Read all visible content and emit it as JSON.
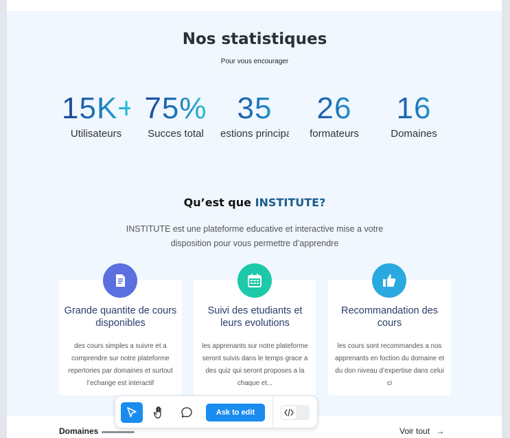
{
  "stats": {
    "title": "Nos statistiques",
    "subtitle": "Pour vous encourager",
    "items": [
      {
        "value": "15K+",
        "label": "Utilisateurs"
      },
      {
        "value": "75%",
        "label": "Succes total"
      },
      {
        "value": "35",
        "label": "estions principa"
      },
      {
        "value": "26",
        "label": "formateurs"
      },
      {
        "value": "16",
        "label": "Domaines"
      }
    ]
  },
  "about": {
    "title_prefix": "Qu’est que ",
    "title_accent": "INSTITUTE?",
    "description": "INSTITUTE est une plateforme educative et interactive mise a votre disposition pour vous permettre d’apprendre"
  },
  "features": [
    {
      "icon": "document-icon",
      "color": "#5b6fe0",
      "title": "Grande quantite de cours disponibles",
      "text": "des cours simples a suivre et a comprendre sur notre plateforme repertories par domaines et surtout l’echange est interactif"
    },
    {
      "icon": "calendar-icon",
      "color": "#1cc9a8",
      "title": "Suivi des etudiants et leurs evolutions",
      "text": "les apprenants sur notre plateforme seront suivis dans le temps grace a des quiz qui seront proposes a la  chaque et..."
    },
    {
      "icon": "thumbs-up-icon",
      "color": "#2aa9e0",
      "title": "Recommandation des cours",
      "text": "les cours sont recommandes a nos apprenants en foction du domaine et du don niveau d’expertise dans celui ci"
    }
  ],
  "footer_peek": {
    "left": "Domaines",
    "right": "Voir tout"
  },
  "toolbar": {
    "ask_label": "Ask to edit",
    "tools": [
      "pointer-icon",
      "hand-icon",
      "comment-icon"
    ],
    "code_icon": "code-icon"
  },
  "colors": {
    "accent": "#1a8cf0",
    "page_bg": "#f0f7fe",
    "title_accent": "#1d5b8c"
  }
}
